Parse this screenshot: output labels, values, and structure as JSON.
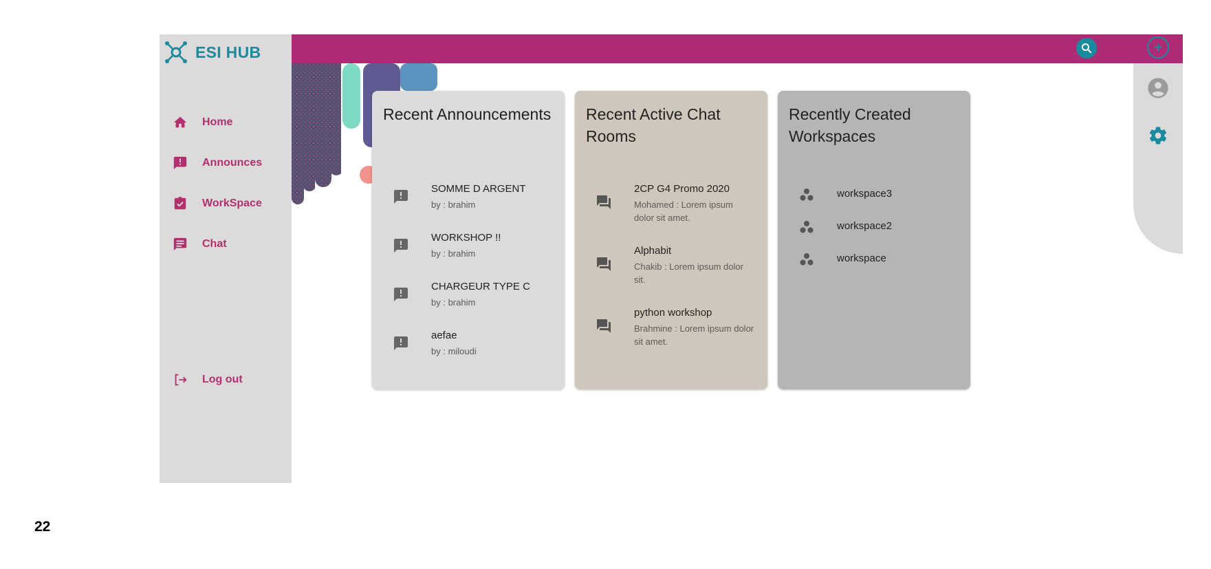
{
  "app": {
    "brand": "ESI HUB"
  },
  "sidebar": {
    "items": [
      {
        "label": "Home",
        "icon": "home-icon"
      },
      {
        "label": "Announces",
        "icon": "announcement-icon"
      },
      {
        "label": "WorkSpace",
        "icon": "assignment-check-icon"
      },
      {
        "label": "Chat",
        "icon": "chat-icon"
      }
    ],
    "logout": {
      "label": "Log out",
      "icon": "logout-icon"
    }
  },
  "topbar": {
    "search_icon": "search-icon",
    "add_icon": "add-circle-icon"
  },
  "rail": {
    "avatar_icon": "account-circle-icon",
    "settings_icon": "gear-icon"
  },
  "cards": {
    "announcements": {
      "title": "Recent Announcements",
      "items": [
        {
          "title": "SOMME D ARGENT",
          "author": "by : brahim"
        },
        {
          "title": "WORKSHOP !!",
          "author": "by : brahim"
        },
        {
          "title": "CHARGEUR TYPE C",
          "author": "by : brahim"
        },
        {
          "title": "aefae",
          "author": "by : miloudi"
        }
      ]
    },
    "chat_rooms": {
      "title": "Recent Active Chat Rooms",
      "items": [
        {
          "name": "2CP G4 Promo 2020",
          "last": "Mohamed : Lorem ipsum dolor sit amet."
        },
        {
          "name": "Alphabit",
          "last": "Chakib : Lorem ipsum dolor sit."
        },
        {
          "name": "python workshop",
          "last": "Brahmine : Lorem ipsum dolor sit amet."
        }
      ]
    },
    "workspaces": {
      "title": "Recently Created Workspaces",
      "items": [
        {
          "name": "workspace3"
        },
        {
          "name": "workspace2"
        },
        {
          "name": "workspace"
        }
      ]
    }
  },
  "page_number": "22",
  "colors": {
    "primary": "#ac2b74",
    "accent": "#1a8a9e",
    "sidebar_bg": "#dcdadb"
  }
}
